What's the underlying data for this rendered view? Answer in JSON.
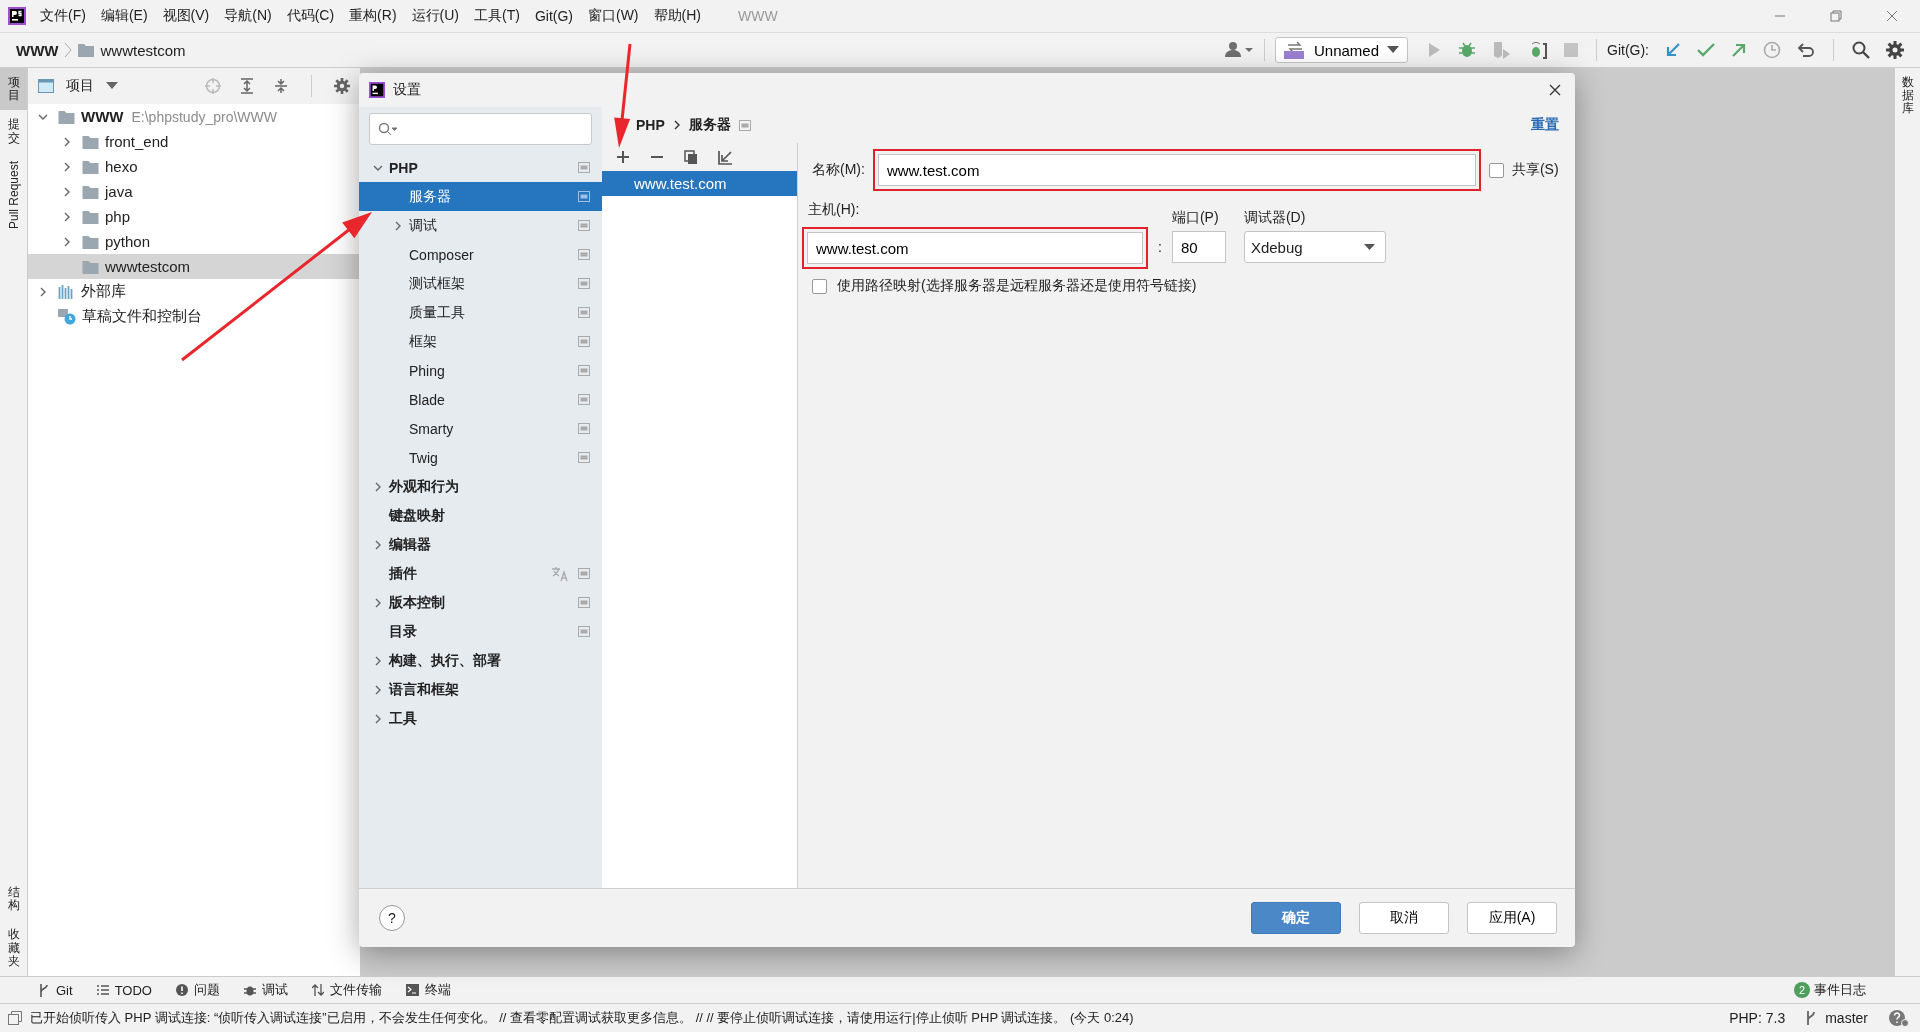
{
  "menu_bar": {
    "menus": [
      "文件(F)",
      "编辑(E)",
      "视图(V)",
      "导航(N)",
      "代码(C)",
      "重构(R)",
      "运行(U)",
      "工具(T)",
      "Git(G)",
      "窗口(W)",
      "帮助(H)"
    ],
    "window_title": "WWW"
  },
  "nav_bar": {
    "breadcrumb": [
      "WWW",
      "wwwtestcom"
    ],
    "run_config": "Unnamed",
    "git_label": "Git(G):"
  },
  "left_stripe": {
    "top": [
      {
        "label": "项目",
        "selected": true
      },
      {
        "label": "提交",
        "selected": false
      },
      {
        "label": "Pull Request",
        "selected": false
      }
    ],
    "bottom": [
      {
        "label": "结构"
      },
      {
        "label": "收藏夹"
      }
    ]
  },
  "right_stripe": {
    "label": "数据库"
  },
  "project_panel": {
    "title": "项目",
    "tree": [
      {
        "name": "WWW",
        "path": "E:\\phpstudy_pro\\WWW",
        "kind": "root",
        "expanded": true,
        "selected": false,
        "children": [
          {
            "name": "front_end",
            "kind": "folder",
            "expanded": false,
            "selected": false
          },
          {
            "name": "hexo",
            "kind": "folder",
            "expanded": false,
            "selected": false
          },
          {
            "name": "java",
            "kind": "folder",
            "expanded": false,
            "selected": false
          },
          {
            "name": "php",
            "kind": "folder",
            "expanded": false,
            "selected": false
          },
          {
            "name": "python",
            "kind": "folder",
            "expanded": false,
            "selected": false
          },
          {
            "name": "wwwtestcom",
            "kind": "folder",
            "selected": true
          }
        ]
      },
      {
        "name": "外部库",
        "kind": "library",
        "expanded": false,
        "selected": false
      },
      {
        "name": "草稿文件和控制台",
        "kind": "scratch",
        "selected": false
      }
    ]
  },
  "settings_dialog": {
    "title": "设置",
    "tree": [
      {
        "label": "PHP",
        "expanded": true,
        "selected": false,
        "project_scope": true,
        "localized": false,
        "children": [
          {
            "label": "服务器",
            "selected": true,
            "project_scope": true,
            "localized": false
          },
          {
            "label": "调试",
            "expanded": false,
            "selected": false,
            "project_scope": true,
            "localized": false
          },
          {
            "label": "Composer",
            "selected": false,
            "project_scope": true,
            "localized": false
          },
          {
            "label": "测试框架",
            "selected": false,
            "project_scope": true,
            "localized": false
          },
          {
            "label": "质量工具",
            "selected": false,
            "project_scope": true,
            "localized": false
          },
          {
            "label": "框架",
            "selected": false,
            "project_scope": true,
            "localized": false
          },
          {
            "label": "Phing",
            "selected": false,
            "project_scope": true,
            "localized": false
          },
          {
            "label": "Blade",
            "selected": false,
            "project_scope": true,
            "localized": false
          },
          {
            "label": "Smarty",
            "selected": false,
            "project_scope": true,
            "localized": false
          },
          {
            "label": "Twig",
            "selected": false,
            "project_scope": true,
            "localized": false
          }
        ]
      },
      {
        "label": "外观和行为",
        "expanded": false,
        "selected": false,
        "project_scope": false,
        "localized": false
      },
      {
        "label": "键盘映射",
        "selected": false,
        "project_scope": false,
        "localized": false
      },
      {
        "label": "编辑器",
        "expanded": false,
        "selected": false,
        "project_scope": false,
        "localized": false
      },
      {
        "label": "插件",
        "selected": false,
        "project_scope": true,
        "localized": true
      },
      {
        "label": "版本控制",
        "expanded": false,
        "selected": false,
        "project_scope": true,
        "localized": false
      },
      {
        "label": "目录",
        "selected": false,
        "project_scope": true,
        "localized": false
      },
      {
        "label": "构建、执行、部署",
        "expanded": false,
        "selected": false,
        "project_scope": false,
        "localized": false
      },
      {
        "label": "语言和框架",
        "expanded": false,
        "selected": false,
        "project_scope": false,
        "localized": false
      },
      {
        "label": "工具",
        "expanded": false,
        "selected": false,
        "project_scope": false,
        "localized": false
      }
    ],
    "breadcrumb": [
      "PHP",
      "服务器"
    ],
    "reset": "重置",
    "servers": [
      {
        "name": "www.test.com",
        "selected": true
      }
    ],
    "form": {
      "name_label": "名称(M):",
      "name": "www.test.com",
      "shared_label": "共享(S)",
      "shared": false,
      "host_label": "主机(H):",
      "host": "www.test.com",
      "separator": ":",
      "port_label": "端口(P)",
      "port": "80",
      "debugger_label": "调试器(D)",
      "debugger": "Xdebug",
      "path_mapping_label": "使用路径映射(选择服务器是远程服务器还是使用符号链接)",
      "path_mapping": false
    },
    "help": "?",
    "buttons": [
      {
        "label": "确定",
        "kind": "primary"
      },
      {
        "label": "取消",
        "kind": "normal"
      },
      {
        "label": "应用(A)",
        "kind": "normal"
      }
    ]
  },
  "tool_strip": {
    "tools": [
      "Git",
      "TODO",
      "问题",
      "调试",
      "文件传输",
      "终端"
    ],
    "event_log": {
      "count": "2",
      "label": "事件日志"
    }
  },
  "status_bar": {
    "message": "已开始侦听传入 PHP 调试连接: “侦听传入调试连接”已启用，不会发生任何变化。 // 查看零配置调试获取更多信息。 // // 要停止侦听调试连接，请使用运行|停止侦听 PHP 调试连接。 (今天 0:24)",
    "php": "PHP: 7.3",
    "branch": "master"
  }
}
